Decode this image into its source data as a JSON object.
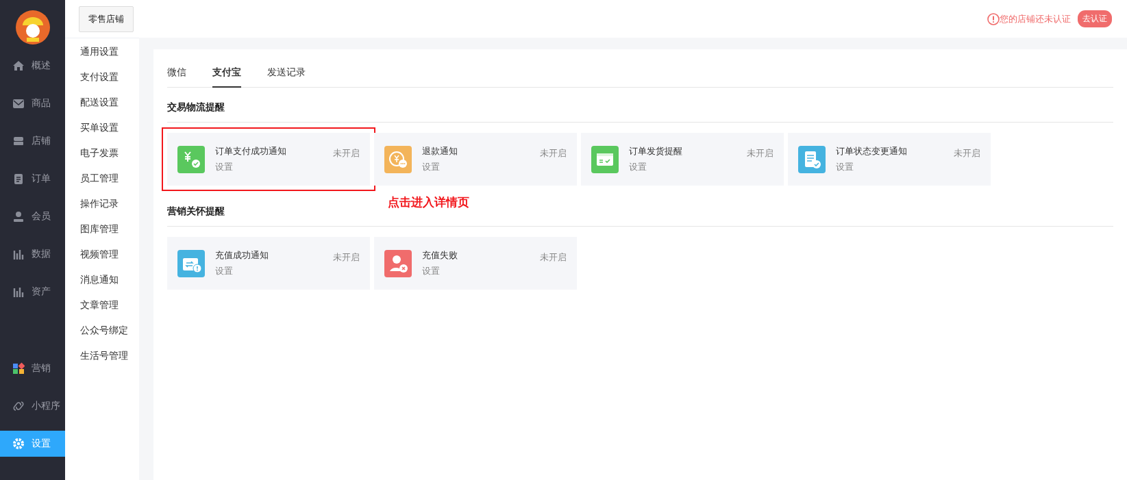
{
  "nav": {
    "items": [
      {
        "label": "概述",
        "selected": false
      },
      {
        "label": "商品",
        "selected": false
      },
      {
        "label": "店铺",
        "selected": false
      },
      {
        "label": "订单",
        "selected": false
      },
      {
        "label": "会员",
        "selected": false
      },
      {
        "label": "数据",
        "selected": false
      },
      {
        "label": "资产",
        "selected": false
      },
      {
        "label": "营销",
        "selected": false
      },
      {
        "label": "小程序",
        "selected": false
      },
      {
        "label": "设置",
        "selected": true
      }
    ]
  },
  "store_button": "零售店铺",
  "notice": {
    "text": "您的店铺还未认证",
    "button": "去认证"
  },
  "submenu": [
    "通用设置",
    "支付设置",
    "配送设置",
    "买单设置",
    "电子发票",
    "员工管理",
    "操作记录",
    "图库管理",
    "视频管理",
    "消息通知",
    "文章管理",
    "公众号绑定",
    "生活号管理"
  ],
  "tabs": [
    {
      "label": "微信",
      "selected": false
    },
    {
      "label": "支付宝",
      "selected": true
    },
    {
      "label": "发送记录",
      "selected": false
    }
  ],
  "sections": [
    {
      "title": "交易物流提醒",
      "cards": [
        {
          "title": "订单支付成功通知",
          "status": "未开启",
          "action": "设置",
          "color": "#5ac85e",
          "outlined": true
        },
        {
          "title": "退款通知",
          "status": "未开启",
          "action": "设置",
          "color": "#f3b45a",
          "outlined": false
        },
        {
          "title": "订单发货提醒",
          "status": "未开启",
          "action": "设置",
          "color": "#5ac85e",
          "outlined": false
        },
        {
          "title": "订单状态变更通知",
          "status": "未开启",
          "action": "设置",
          "color": "#45b3e0",
          "outlined": false
        }
      ]
    },
    {
      "title": "营销关怀提醒",
      "cards": [
        {
          "title": "充值成功通知",
          "status": "未开启",
          "action": "设置",
          "color": "#45b3e0",
          "outlined": false
        },
        {
          "title": "充值失败",
          "status": "未开启",
          "action": "设置",
          "color": "#f06c6c",
          "outlined": false
        }
      ]
    }
  ],
  "annotation": "点击进入详情页"
}
